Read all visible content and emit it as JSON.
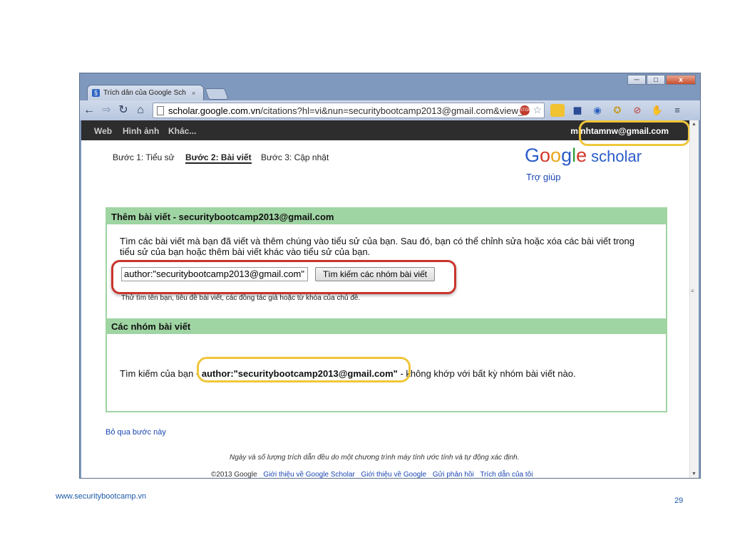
{
  "browser": {
    "tab_title": "Trích dẫn của Google Sch",
    "tab_close": "×",
    "url_host": "scholar.google.com.vn",
    "url_path": "/citations?hl=vi&nun=securitybootcamp2013@gmail.com&view_",
    "window_controls": [
      "─",
      "□",
      "x"
    ]
  },
  "gbar": {
    "links": [
      "Web",
      "Hình ảnh",
      "Khác..."
    ],
    "email": "minhtamnw@gmail.com"
  },
  "steps": [
    "Bước 1: Tiểu sử",
    "Bước 2: Bài viết",
    "Bước 3: Cập nhật"
  ],
  "logo": {
    "letters": [
      "G",
      "o",
      "o",
      "g",
      "l",
      "e"
    ],
    "word": "scholar"
  },
  "help": "Trợ giúp",
  "add_section": {
    "title": "Thêm bài viết - securitybootcamp2013@gmail.com",
    "intro": "Tìm các bài viết mà bạn đã viết và thêm chúng vào tiểu sử của bạn. Sau đó, bạn có thể chỉnh sửa hoặc xóa các bài viết trong tiểu sử của bạn hoặc thêm bài viết khác vào tiểu sử của bạn.",
    "search_value": "author:\"securitybootcamp2013@gmail.com\"",
    "search_button": "Tìm kiếm các nhóm bài viết",
    "hint": "Thử tìm tên bạn, tiêu đề bài viết, các đồng tác giả hoặc từ khóa của chủ đề."
  },
  "groups_section": {
    "title": "Các nhóm bài viết",
    "result_prefix": "Tìm kiếm của bạn - ",
    "result_query": "author:\"securitybootcamp2013@gmail.com\"",
    "result_suffix": " - không khớp với bất kỳ nhóm bài viết nào."
  },
  "skip_link": "Bỏ qua bước này",
  "note": "Ngày và số lượng trích dẫn đều do một chương trình máy tính ước tính và tự động xác định.",
  "footer": {
    "copyright": "©2013 Google",
    "links": [
      "Giới thiệu về Google Scholar",
      "Giới thiệu về Google",
      "Gửi phản hồi",
      "Trích dẫn của tôi"
    ]
  },
  "slide": {
    "site": "www.securitybootcamp.vn",
    "page": "29"
  },
  "colors": {
    "section_band": "#9fd4a3",
    "highlight_red": "#c9342c",
    "highlight_yellow": "#f0c63a",
    "gbar_bg": "#2d2d2d"
  }
}
